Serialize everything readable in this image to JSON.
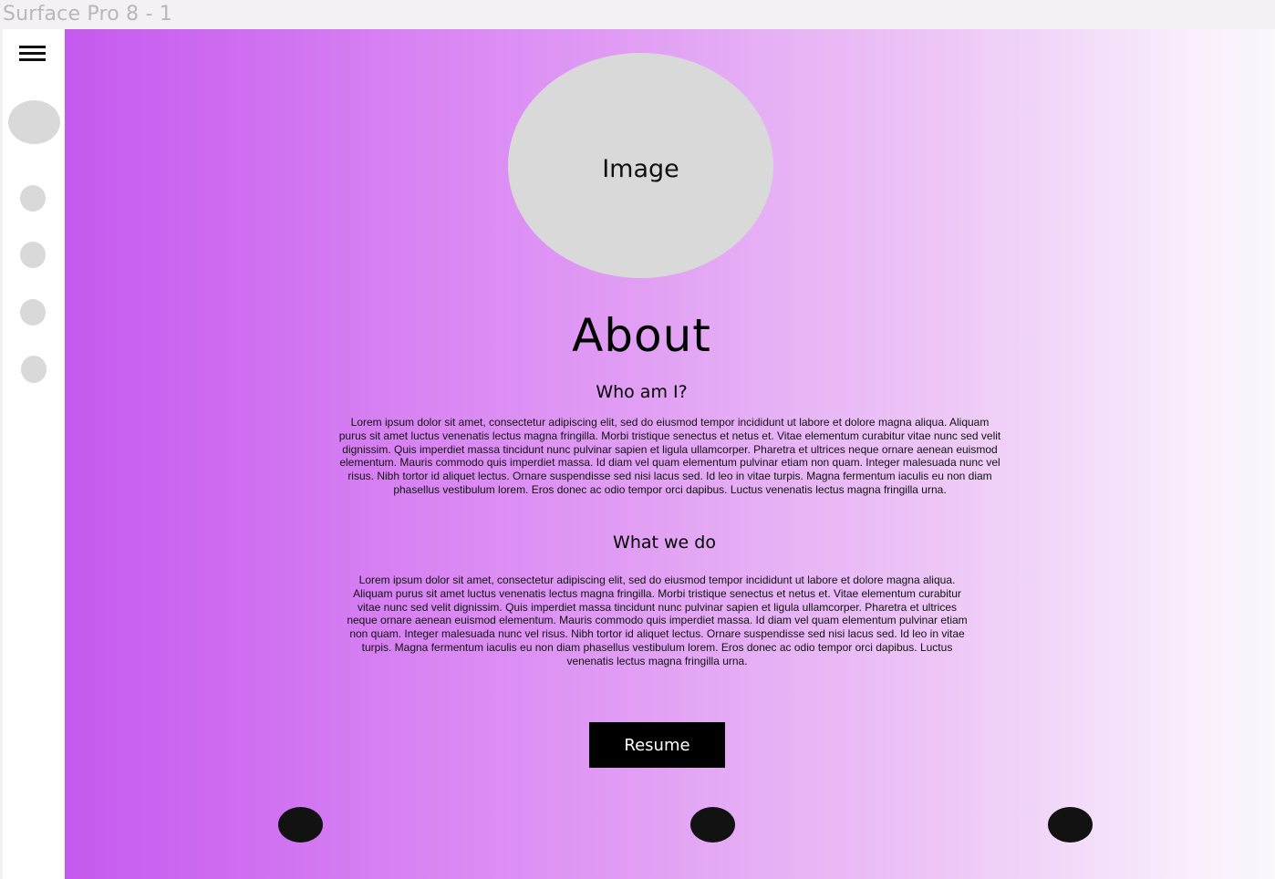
{
  "frame": {
    "title": "Surface Pro 8 - 1"
  },
  "sidebar": {
    "menu_icon": "hamburger-menu-icon",
    "avatar": "avatar-placeholder",
    "nav_items": [
      {
        "icon": "nav-circle-icon"
      },
      {
        "icon": "nav-circle-icon"
      },
      {
        "icon": "nav-circle-icon"
      },
      {
        "icon": "nav-circle-icon"
      }
    ]
  },
  "main": {
    "image_label": "Image",
    "title": "About",
    "who_heading": "Who am I?",
    "who_body": "Lorem ipsum dolor sit amet, consectetur adipiscing elit, sed do eiusmod tempor incididunt ut labore et dolore magna aliqua. Aliquam purus sit amet luctus venenatis lectus magna fringilla. Morbi tristique senectus et netus et. Vitae elementum curabitur vitae nunc sed velit dignissim. Quis imperdiet massa tincidunt nunc pulvinar sapien et ligula ullamcorper. Pharetra et ultrices neque ornare aenean euismod elementum. Mauris commodo quis imperdiet massa. Id diam vel quam elementum pulvinar etiam non quam. Integer malesuada nunc vel risus. Nibh tortor id aliquet lectus. Ornare suspendisse sed nisi lacus sed. Id leo in vitae turpis. Magna fermentum iaculis eu non diam phasellus vestibulum lorem. Eros donec ac odio tempor orci dapibus. Luctus venenatis lectus magna fringilla urna.",
    "what_heading": "What we do",
    "what_body": "Lorem ipsum dolor sit amet, consectetur adipiscing elit, sed do eiusmod tempor incididunt ut labore et dolore magna aliqua. Aliquam purus sit amet luctus venenatis lectus magna fringilla. Morbi tristique senectus et netus et. Vitae elementum curabitur vitae nunc sed velit dignissim. Quis imperdiet massa tincidunt nunc pulvinar sapien et ligula ullamcorper. Pharetra et ultrices neque ornare aenean euismod elementum. Mauris commodo quis imperdiet massa. Id diam vel quam elementum pulvinar etiam non quam. Integer malesuada nunc vel risus. Nibh tortor id aliquet lectus. Ornare suspendisse sed nisi lacus sed. Id leo in vitae turpis. Magna fermentum iaculis eu non diam phasellus vestibulum lorem. Eros donec ac odio tempor orci dapibus. Luctus venenatis lectus magna fringilla urna.",
    "resume_label": "Resume",
    "social_icons": [
      "social-circle-icon",
      "social-circle-icon",
      "social-circle-icon"
    ]
  },
  "colors": {
    "gradient_start": "#c65aef",
    "gradient_end": "#fbf7fd",
    "placeholder": "#d9d9d9",
    "button": "#000000",
    "social": "#121212"
  }
}
